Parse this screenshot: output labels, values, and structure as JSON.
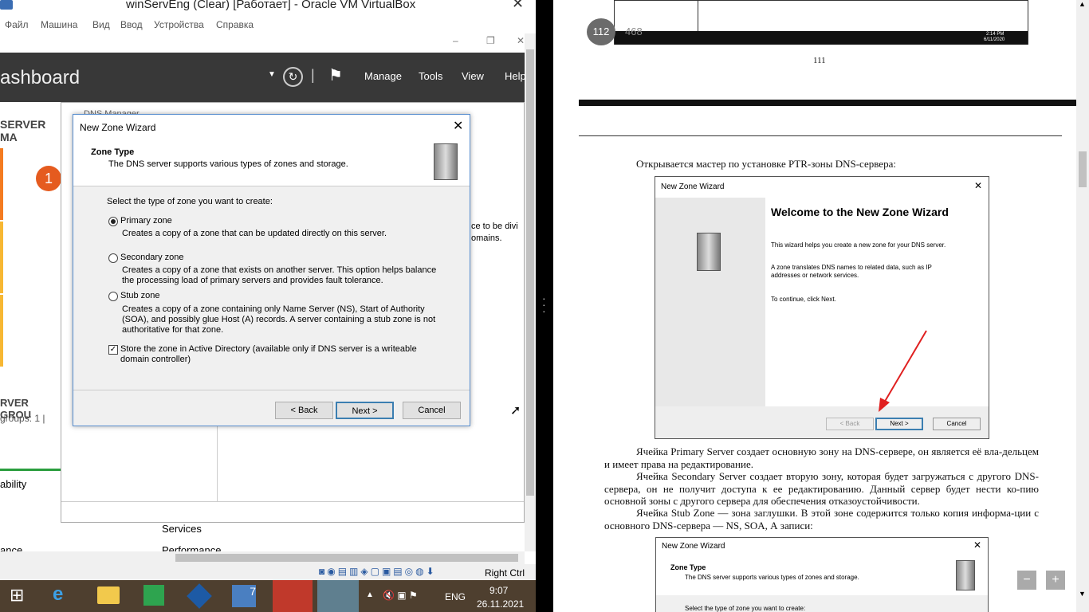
{
  "vbox": {
    "title": "winServEng (Clear) [Работает] - Oracle VM VirtualBox",
    "menu": [
      "Файл",
      "Машина",
      "Вид",
      "Ввод",
      "Устройства",
      "Справка"
    ],
    "host_key": "Right Ctrl"
  },
  "server_manager": {
    "title": "ashboard",
    "menu": [
      "Manage",
      "Tools",
      "View",
      "Help"
    ],
    "left_label": "SERVER MA",
    "badge": "1",
    "groups_title": "RVER GROU",
    "groups_sub": "groups: 1   |",
    "ability": "ability",
    "services": "Services",
    "performance": "Performance",
    "ance": "ance"
  },
  "dns_manager": {
    "title": "DNS Manager",
    "text1": "ce to be divi",
    "text2": "omains."
  },
  "wizard": {
    "title": "New Zone Wizard",
    "heading": "Zone Type",
    "subheading": "The DNS server supports various types of zones and storage.",
    "prompt": "Select the type of zone you want to create:",
    "options": [
      {
        "label": "Primary zone",
        "desc": "Creates a copy of a zone that can be updated directly on this server.",
        "selected": true
      },
      {
        "label": "Secondary zone",
        "desc": "Creates a copy of a zone that exists on another server. This option helps balance the processing load of primary servers and provides fault tolerance.",
        "selected": false
      },
      {
        "label": "Stub zone",
        "desc": "Creates a copy of a zone containing only Name Server (NS), Start of Authority (SOA), and possibly glue Host (A) records. A server containing a stub zone is not authoritative for that zone.",
        "selected": false
      }
    ],
    "store_ad": "Store the zone in Active Directory (available only if DNS server is a writeable domain controller)",
    "store_ad_checked": true,
    "back": "< Back",
    "next": "Next >",
    "cancel": "Cancel"
  },
  "taskbar": {
    "lang": "ENG",
    "time": "9:07",
    "date": "26.11.2021"
  },
  "pdf": {
    "page_badge": "112",
    "page_total": "468",
    "page_number": "111",
    "intro": "Открывается мастер по установке PTR-зоны DNS-сервера:",
    "fig1": {
      "title": "New Zone Wizard",
      "heading": "Welcome to the New Zone Wizard",
      "p1": "This wizard helps you create a new zone for your DNS server.",
      "p2": "A zone translates DNS names to related data, such as IP addresses or network services.",
      "p3": "To continue, click Next.",
      "back": "< Back",
      "next": "Next >",
      "cancel": "Cancel"
    },
    "para1": "Ячейка Primary Server создает основную зону на DNS-сервере, он является её вла-дельцем и имеет права на редактирование.",
    "para2": "Ячейка Secondary Server создает вторую зону, которая будет загружаться с другого DNS-сервера, он не получит доступа к ее редактированию. Данный сервер будет нести ко-пию основной зоны с другого сервера для обеспечения отказоустойчивости.",
    "para3": "Ячейка Stub Zone — зона заглушки. В этой зоне содержится только копия информа-ции с основного DNS-сервера — NS, SOA, А записи:",
    "fig2": {
      "title": "New Zone Wizard",
      "heading": "Zone Type",
      "sub": "The DNS server supports various types of zones and storage.",
      "prompt": "Select the type of zone you want to create:"
    },
    "thumb": {
      "time": "2:14 PM",
      "date": "6/11/2020"
    },
    "zoom_out": "−",
    "zoom_in": "+"
  }
}
